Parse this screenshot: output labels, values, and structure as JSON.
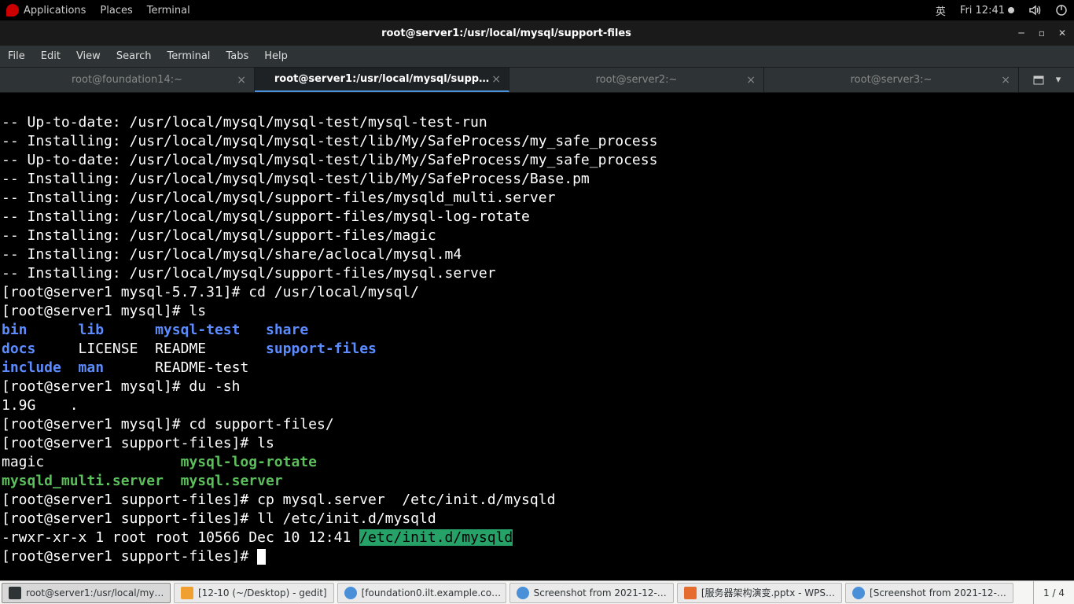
{
  "topbar": {
    "applications": "Applications",
    "places": "Places",
    "terminal": "Terminal",
    "ime": "英",
    "datetime": "Fri 12:41"
  },
  "titlebar": {
    "title": "root@server1:/usr/local/mysql/support-files"
  },
  "menubar": {
    "file": "File",
    "edit": "Edit",
    "view": "View",
    "search": "Search",
    "terminal": "Terminal",
    "tabs": "Tabs",
    "help": "Help"
  },
  "tabs": [
    {
      "label": "root@foundation14:~",
      "active": false
    },
    {
      "label": "root@server1:/usr/local/mysql/supp…",
      "active": true
    },
    {
      "label": "root@server2:~",
      "active": false
    },
    {
      "label": "root@server3:~",
      "active": false
    }
  ],
  "term": {
    "l1": "-- Up-to-date: /usr/local/mysql/mysql-test/mysql-test-run",
    "l2": "-- Installing: /usr/local/mysql/mysql-test/lib/My/SafeProcess/my_safe_process",
    "l3": "-- Up-to-date: /usr/local/mysql/mysql-test/lib/My/SafeProcess/my_safe_process",
    "l4": "-- Installing: /usr/local/mysql/mysql-test/lib/My/SafeProcess/Base.pm",
    "l5": "-- Installing: /usr/local/mysql/support-files/mysqld_multi.server",
    "l6": "-- Installing: /usr/local/mysql/support-files/mysql-log-rotate",
    "l7": "-- Installing: /usr/local/mysql/support-files/magic",
    "l8": "-- Installing: /usr/local/mysql/share/aclocal/mysql.m4",
    "l9": "-- Installing: /usr/local/mysql/support-files/mysql.server",
    "p1": "[root@server1 mysql-5.7.31]# ",
    "c1": "cd /usr/local/mysql/",
    "p2": "[root@server1 mysql]# ",
    "c2": "ls",
    "ls1_a": "bin",
    "ls1_b": "lib",
    "ls1_c": "mysql-test",
    "ls1_d": "share",
    "ls2_a": "docs",
    "ls2_b": "LICENSE",
    "ls2_c": "README",
    "ls2_d": "support-files",
    "ls3_a": "include",
    "ls3_b": "man",
    "ls3_c": "README-test",
    "c3": "du -sh",
    "du_out": "1.9G\t.",
    "c4": "cd support-files/",
    "p3": "[root@server1 support-files]# ",
    "c5": "ls",
    "sf1_a": "magic",
    "sf1_b": "mysql-log-rotate",
    "sf2_a": "mysqld_multi.server",
    "sf2_b": "mysql.server",
    "c6": "cp mysql.server  /etc/init.d/mysqld",
    "c7": "ll /etc/init.d/mysqld",
    "ll_pre": "-rwxr-xr-x 1 root root 10566 Dec 10 12:41 ",
    "ll_hl": "/etc/init.d/mysqld"
  },
  "taskbar": {
    "items": [
      {
        "label": "root@server1:/usr/local/my…",
        "active": true,
        "icon": "#2e3436"
      },
      {
        "label": "[12-10 (~/Desktop) - gedit]",
        "icon": "#f0a030"
      },
      {
        "label": "[foundation0.ilt.example.co…",
        "icon": "#4a90d9"
      },
      {
        "label": "Screenshot from 2021-12-…",
        "icon": "#4a90d9"
      },
      {
        "label": "[服务器架构演变.pptx - WPS…",
        "icon": "#e66b2e"
      },
      {
        "label": "[Screenshot from 2021-12-…",
        "icon": "#4a90d9"
      }
    ],
    "workspace": "1 / 4"
  }
}
